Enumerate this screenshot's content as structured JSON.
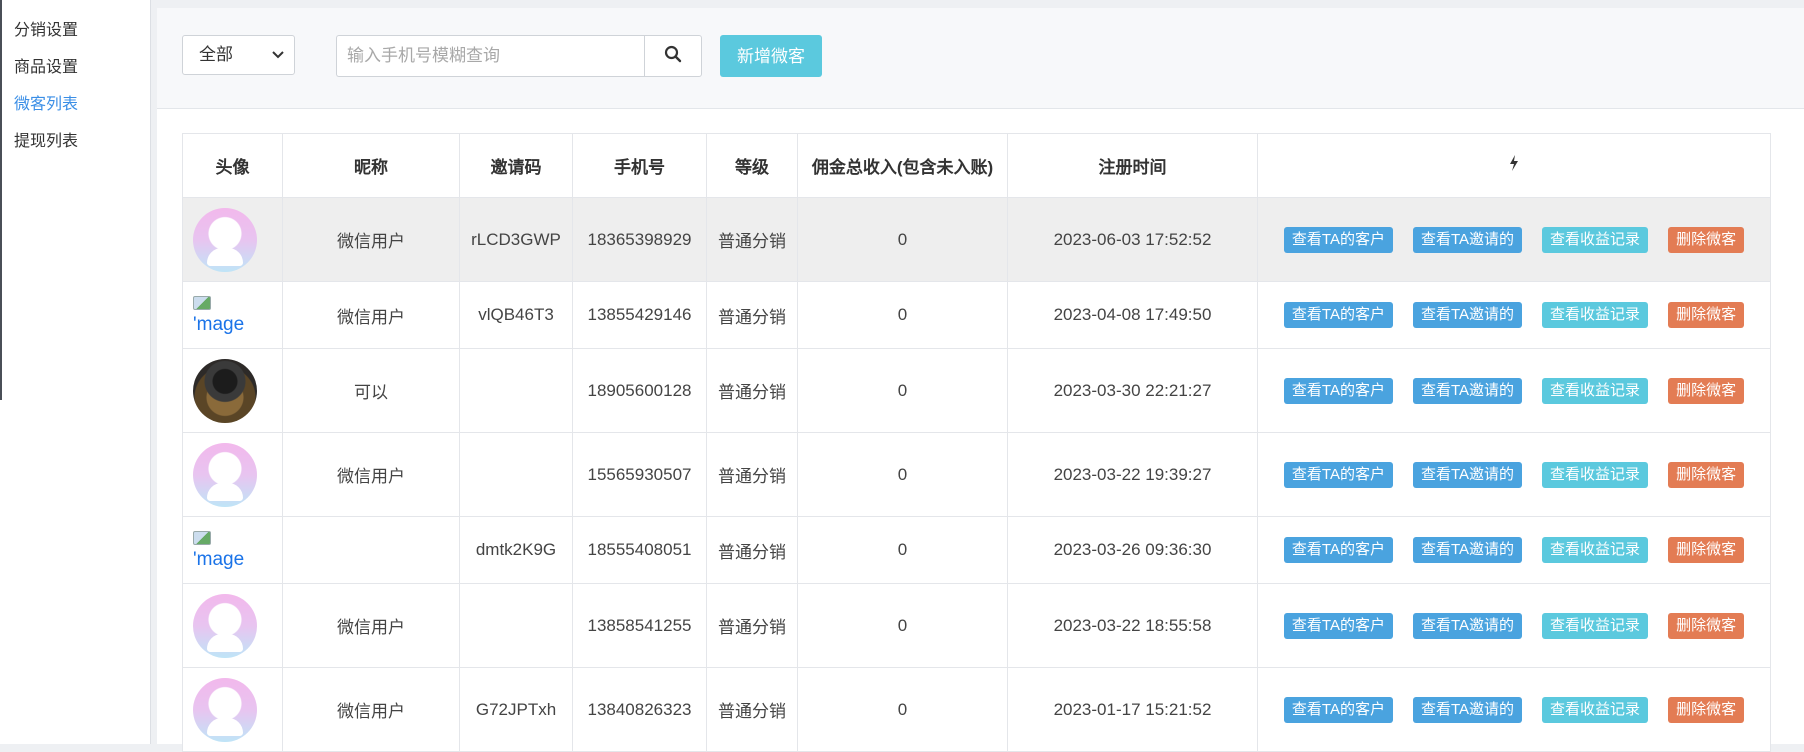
{
  "sidebar": {
    "items": [
      {
        "label": "分销设置",
        "active": false
      },
      {
        "label": "商品设置",
        "active": false
      },
      {
        "label": "微客列表",
        "active": true
      },
      {
        "label": "提现列表",
        "active": false
      }
    ]
  },
  "toolbar": {
    "filter_selected": "全部",
    "search_placeholder": "输入手机号模糊查询",
    "search_icon": "search-icon",
    "add_label": "新增微客"
  },
  "table": {
    "headers": [
      "头像",
      "昵称",
      "邀请码",
      "手机号",
      "等级",
      "佣金总收入(包含未入账)",
      "注册时间",
      "⚡"
    ],
    "actions": [
      "查看TA的客户",
      "查看TA邀请的",
      "查看收益记录",
      "删除微客"
    ],
    "broken_image_text": "'mage",
    "rows": [
      {
        "avatar": "default",
        "nickname": "微信用户",
        "code": "rLCD3GWP",
        "phone": "18365398929",
        "level": "普通分销",
        "commission": "0",
        "time": "2023-06-03 17:52:52"
      },
      {
        "avatar": "broken",
        "nickname": "微信用户",
        "code": "vlQB46T3",
        "phone": "13855429146",
        "level": "普通分销",
        "commission": "0",
        "time": "2023-04-08 17:49:50"
      },
      {
        "avatar": "photo",
        "nickname": "可以",
        "code": "",
        "phone": "18905600128",
        "level": "普通分销",
        "commission": "0",
        "time": "2023-03-30 22:21:27"
      },
      {
        "avatar": "default",
        "nickname": "微信用户",
        "code": "",
        "phone": "15565930507",
        "level": "普通分销",
        "commission": "0",
        "time": "2023-03-22 19:39:27"
      },
      {
        "avatar": "broken",
        "nickname": "",
        "code": "dmtk2K9G",
        "phone": "18555408051",
        "level": "普通分销",
        "commission": "0",
        "time": "2023-03-26 09:36:30"
      },
      {
        "avatar": "default",
        "nickname": "微信用户",
        "code": "",
        "phone": "13858541255",
        "level": "普通分销",
        "commission": "0",
        "time": "2023-03-22 18:55:58"
      },
      {
        "avatar": "default",
        "nickname": "微信用户",
        "code": "G72JPTxh",
        "phone": "13840826323",
        "level": "普通分销",
        "commission": "0",
        "time": "2023-01-17 15:21:52"
      }
    ]
  },
  "colors": {
    "accent": "#3a8ee6",
    "add_button": "#5bc9de",
    "action_blue": "#4aa3df",
    "action_cyan": "#5bc9de",
    "action_red": "#e37c54",
    "row_highlight": "#eeeeee"
  }
}
